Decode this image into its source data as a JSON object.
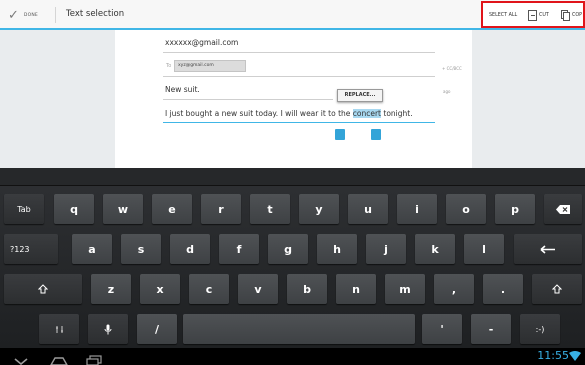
{
  "action_bar": {
    "done_label": "DONE",
    "title": "Text selection",
    "select_all_label": "SELECT ALL",
    "cut_label": "CUT",
    "copy_label": "COP",
    "highlight_color": "#e0141a",
    "accent_color": "#40b6e6"
  },
  "compose": {
    "from": "xxxxxx@gmail.com",
    "to_label": "To",
    "to_chip": "xyz@gmail.com",
    "cc_bcc_label": "+ CC/BCC",
    "subject": "New suit.",
    "replace_label": "REPLACE...",
    "bcc_side_label": "ago",
    "body_before": "I just bought a new suit today. I will wear it to the ",
    "body_selected": "concert",
    "body_after": " tonight."
  },
  "keyboard": {
    "row1": [
      "Tab",
      "q",
      "w",
      "e",
      "r",
      "t",
      "y",
      "u",
      "i",
      "o",
      "p",
      "backspace-icon"
    ],
    "row2": [
      "?123",
      "a",
      "s",
      "d",
      "f",
      "g",
      "h",
      "j",
      "k",
      "l",
      "enter-icon"
    ],
    "row3": [
      "shift-icon",
      "z",
      "x",
      "c",
      "v",
      "b",
      "n",
      "m",
      ",",
      ".",
      "shift-icon"
    ],
    "row4": [
      "settings-icon",
      "microphone-icon",
      "/",
      "space",
      "'",
      "-",
      ":-)"
    ]
  },
  "nav_bar": {
    "clock": "11:55",
    "icons": [
      "back-icon",
      "home-icon",
      "recent-apps-icon",
      "wifi-icon",
      "battery-icon"
    ]
  }
}
